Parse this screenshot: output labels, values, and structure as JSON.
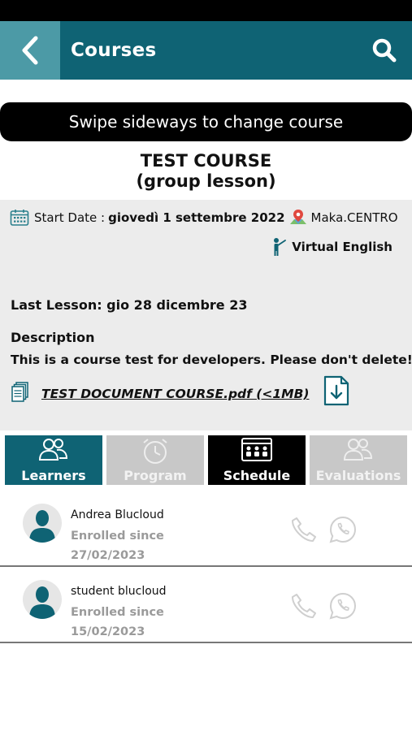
{
  "header": {
    "title": "Courses"
  },
  "banner": {
    "text": "Swipe sideways to change course"
  },
  "course": {
    "title": "TEST COURSE",
    "subtitle": "(group lesson)",
    "start_date_label": "Start Date :",
    "start_date_value": "giovedì 1 settembre 2022",
    "location": "Maka.CENTRO",
    "teacher": "Virtual English",
    "last_lesson": "Last Lesson: gio 28 dicembre 23",
    "description_heading": "Description",
    "description_text": "This is a course test for developers. Please don't delete!",
    "document_name": "TEST DOCUMENT COURSE.pdf (<1MB)"
  },
  "tabs": [
    {
      "label": "Learners",
      "icon": "group-icon",
      "state": "active"
    },
    {
      "label": "Program",
      "icon": "clock-icon",
      "state": "disabled"
    },
    {
      "label": "Schedule",
      "icon": "classroom-icon",
      "state": "dark"
    },
    {
      "label": "Evaluations",
      "icon": "group-icon",
      "state": "disabled"
    }
  ],
  "learners": [
    {
      "name": "Andrea Blucloud",
      "since_label": "Enrolled since",
      "since_date": "27/02/2023"
    },
    {
      "name": "student blucloud",
      "since_label": "Enrolled since",
      "since_date": "15/02/2023"
    }
  ],
  "colors": {
    "primary": "#0f6374",
    "back_button": "#4c9aa6",
    "panel": "#ececec",
    "muted_tab": "#c8c8c8"
  }
}
